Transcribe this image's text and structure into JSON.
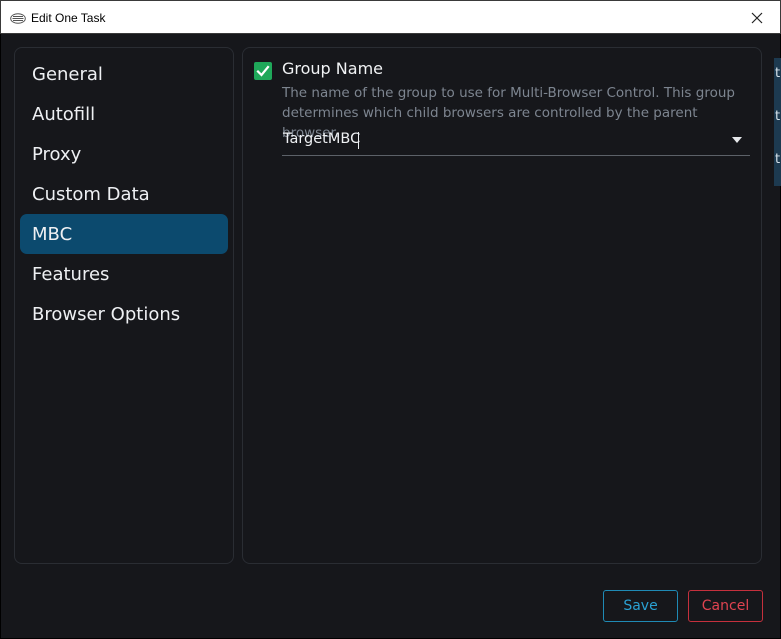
{
  "window": {
    "title": "Edit One Task",
    "icon": "app-logo-icon",
    "close_icon": "close-icon"
  },
  "sidebar": {
    "items": [
      {
        "label": "General",
        "active": false
      },
      {
        "label": "Autofill",
        "active": false
      },
      {
        "label": "Proxy",
        "active": false
      },
      {
        "label": "Custom Data",
        "active": false
      },
      {
        "label": "MBC",
        "active": true
      },
      {
        "label": "Features",
        "active": false
      },
      {
        "label": "Browser Options",
        "active": false
      }
    ]
  },
  "main": {
    "group_name": {
      "checked": true,
      "label": "Group Name",
      "description": "The name of the group to use for Multi-Browser Control. This group determines which child browsers are controlled by the parent browser.",
      "selected_value": "TargetMBC"
    }
  },
  "footer": {
    "save_label": "Save",
    "cancel_label": "Cancel"
  },
  "colors": {
    "background": "#16171b",
    "active_nav": "#0c4a6e",
    "checkbox": "#1fa85a",
    "save": "#2aa1d3",
    "cancel": "#e04350"
  }
}
